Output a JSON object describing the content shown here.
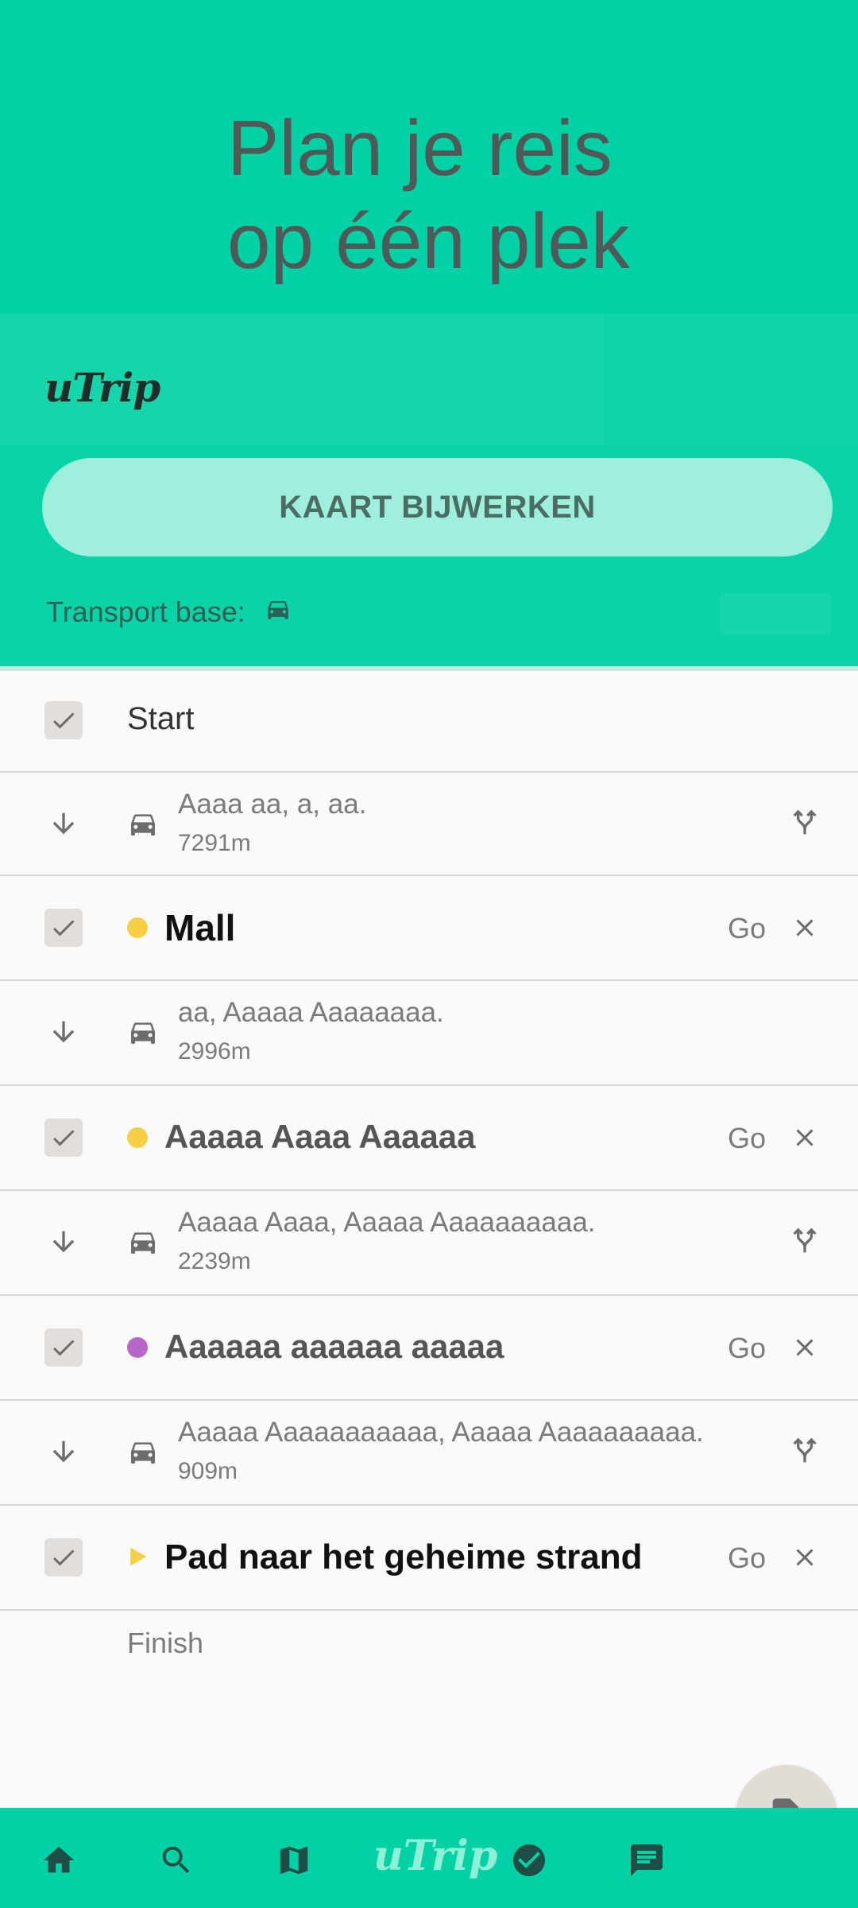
{
  "hero": {
    "line1": "Plan je reis",
    "line2": "op één plek"
  },
  "brand": "uTrip",
  "refresh_button": "KAART BIJWERKEN",
  "transport": {
    "label": "Transport base:",
    "icon": "car-icon"
  },
  "start_label": "Start",
  "finish_label": "Finish",
  "stops": [
    {
      "title": "Mall",
      "go": "Go",
      "dot_color": "#f6cf45"
    },
    {
      "title": "Aaaaa Aaaa Aaaaaa",
      "go": "Go",
      "dot_color": "#f6cf45"
    },
    {
      "title": "Aaaaaa aaaaaa aaaaa",
      "go": "Go",
      "dot_color": "#b966c9"
    },
    {
      "title": "Pad naar het geheime strand",
      "go": "Go",
      "marker": "play-triangle",
      "marker_color": "#f6cf45"
    }
  ],
  "legs": [
    {
      "text": "Aaaa aa, a, aa.",
      "distance": "7291m"
    },
    {
      "text": "aa, Aaaaa Aaaaaaaa.",
      "distance": "2996m"
    },
    {
      "text": "Aaaaa Aaaa, Aaaaa Aaaaaaaaaa.",
      "distance": "2239m"
    },
    {
      "text": "Aaaaa Aaaaaaaaaaa, Aaaaa Aaaaaaaaaa.",
      "distance": "909m"
    }
  ],
  "nav": {
    "brand": "uTrip",
    "items": [
      "home-icon",
      "search-icon",
      "map-icon",
      "check-circle-icon",
      "chat-icon"
    ]
  },
  "colors": {
    "primary": "#02d1a5",
    "button_light": "#9eefdc"
  }
}
